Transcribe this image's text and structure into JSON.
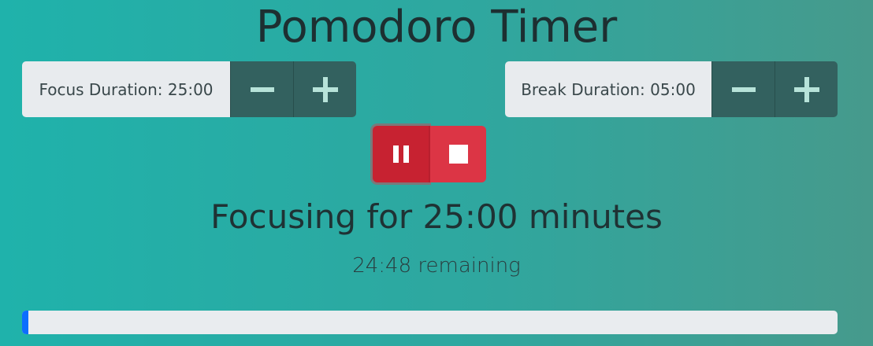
{
  "title": "Pomodoro Timer",
  "focus": {
    "label": "Focus Duration: 25:00",
    "minus_icon": "minus-icon",
    "plus_icon": "plus-icon"
  },
  "break": {
    "label": "Break Duration: 05:00",
    "minus_icon": "minus-icon",
    "plus_icon": "plus-icon"
  },
  "controls": {
    "pause_icon": "pause-icon",
    "stop_icon": "stop-icon"
  },
  "status": "Focusing for 25:00 minutes",
  "remaining": "24:48 remaining",
  "progress": {
    "fraction": 0.008
  },
  "colors": {
    "accent": "#33615f",
    "pause": "#c72231",
    "stop": "#dc3545",
    "progress": "#0d6efd"
  }
}
